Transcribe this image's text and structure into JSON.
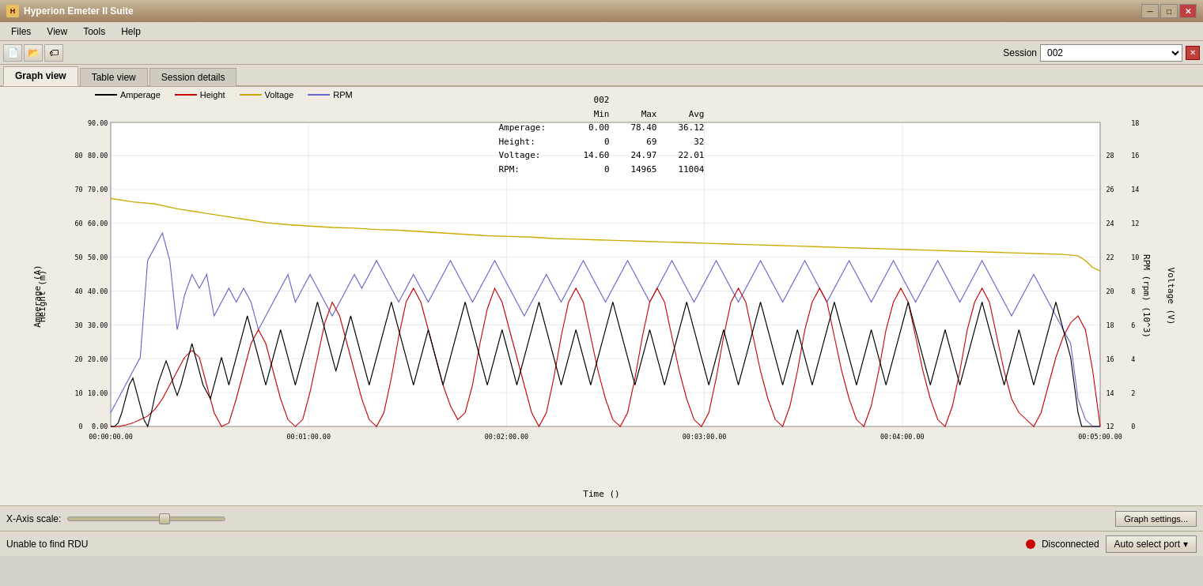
{
  "titleBar": {
    "title": "Hyperion Emeter II Suite",
    "minimize": "─",
    "maximize": "□",
    "close": "✕"
  },
  "menuBar": {
    "items": [
      "Files",
      "View",
      "Tools",
      "Help"
    ]
  },
  "toolbar": {
    "buttons": [
      "📄",
      "📂",
      "🏷"
    ],
    "sessionLabel": "Session",
    "sessionValue": "002",
    "closeBtn": "✕"
  },
  "tabs": [
    {
      "label": "Graph view",
      "active": true
    },
    {
      "label": "Table view",
      "active": false
    },
    {
      "label": "Session details",
      "active": false
    }
  ],
  "stats": {
    "session": "002",
    "headers": [
      "",
      "Min",
      "Max",
      "Avg"
    ],
    "rows": [
      {
        "label": "Amperage:",
        "min": "0.00",
        "max": "78.40",
        "avg": "36.12"
      },
      {
        "label": "Height:",
        "min": "0",
        "max": "69",
        "avg": "32"
      },
      {
        "label": "Voltage:",
        "min": "14.60",
        "max": "24.97",
        "avg": "22.01"
      },
      {
        "label": "RPM:",
        "min": "0",
        "max": "14965",
        "avg": "11004"
      }
    ]
  },
  "legend": [
    {
      "label": "Amperage",
      "color": "#000000"
    },
    {
      "label": "Height",
      "color": "#cc0000"
    },
    {
      "label": "Voltage",
      "color": "#ccaa00"
    },
    {
      "label": "RPM",
      "color": "#6666cc"
    }
  ],
  "chart": {
    "xAxisLabel": "Time ()",
    "yLeftLabel1": "Height (m)",
    "yLeftLabel2": "Amperage (A)",
    "yRightLabel1": "Voltage (V)",
    "yRightLabel2": "RPM (rpm) (10^3)",
    "xTicks": [
      "00:00:00.00",
      "00:01:00.00",
      "00:02:00.00",
      "00:03:00.00",
      "00:04:00.00",
      "00:05:00.00"
    ],
    "yLeftTicks": [
      "0",
      "10",
      "20",
      "30",
      "40",
      "50",
      "60",
      "70",
      "80"
    ],
    "yRightTicksV": [
      "12",
      "14",
      "16",
      "18",
      "20",
      "22",
      "24",
      "26",
      "28"
    ],
    "yRightTicksRPM": [
      "0",
      "2",
      "4",
      "6",
      "8",
      "10",
      "12",
      "14",
      "16",
      "18"
    ],
    "yLeftTicksAmp": [
      "0.00",
      "10.00",
      "20.00",
      "30.00",
      "40.00",
      "50.00",
      "60.00",
      "70.00",
      "80.00",
      "90.00"
    ]
  },
  "bottomBar": {
    "xAxisScaleLabel": "X-Axis scale:",
    "graphSettingsBtn": "Graph settings..."
  },
  "statusBar": {
    "statusText": "Unable to find RDU",
    "disconnectedLabel": "Disconnected",
    "autoSelectLabel": "Auto select port"
  }
}
